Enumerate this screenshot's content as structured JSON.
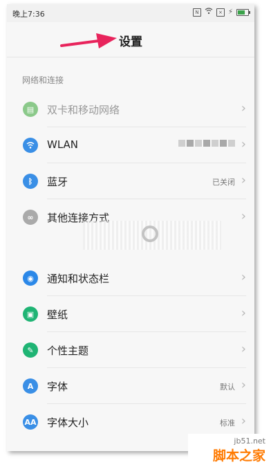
{
  "status_bar": {
    "time": "晚上7:36",
    "icons": [
      "nfc-icon",
      "wifi-icon",
      "sim-off-icon",
      "battery-icon"
    ]
  },
  "header": {
    "title": "设置"
  },
  "section": {
    "title": "网络和连接"
  },
  "rows": [
    {
      "label": "双卡和移动网络",
      "value": "",
      "icon": "sim-card-icon",
      "color": "#8bc98a"
    },
    {
      "label": "WLAN",
      "value": "",
      "icon": "wifi-icon",
      "color": "#3a8fe6"
    },
    {
      "label": "蓝牙",
      "value": "已关闭",
      "icon": "bluetooth-icon",
      "color": "#3a8fe6"
    },
    {
      "label": "其他连接方式",
      "value": "",
      "icon": "link-icon",
      "color": "#aaaaaa"
    },
    {
      "label": "通知和状态栏",
      "value": "",
      "icon": "notification-icon",
      "color": "#2b88e8"
    },
    {
      "label": "壁纸",
      "value": "",
      "icon": "wallpaper-icon",
      "color": "#1fb474"
    },
    {
      "label": "个性主题",
      "value": "",
      "icon": "theme-icon",
      "color": "#1fb474"
    },
    {
      "label": "字体",
      "value": "默认",
      "icon": "font-icon",
      "color": "#3a8fe6"
    },
    {
      "label": "字体大小",
      "value": "标准",
      "icon": "font-size-icon",
      "color": "#3a8fe6"
    }
  ],
  "watermark": {
    "line1": "jb51.net",
    "line2": "脚本之家"
  },
  "colors": {
    "arrow": "#e8245c"
  }
}
